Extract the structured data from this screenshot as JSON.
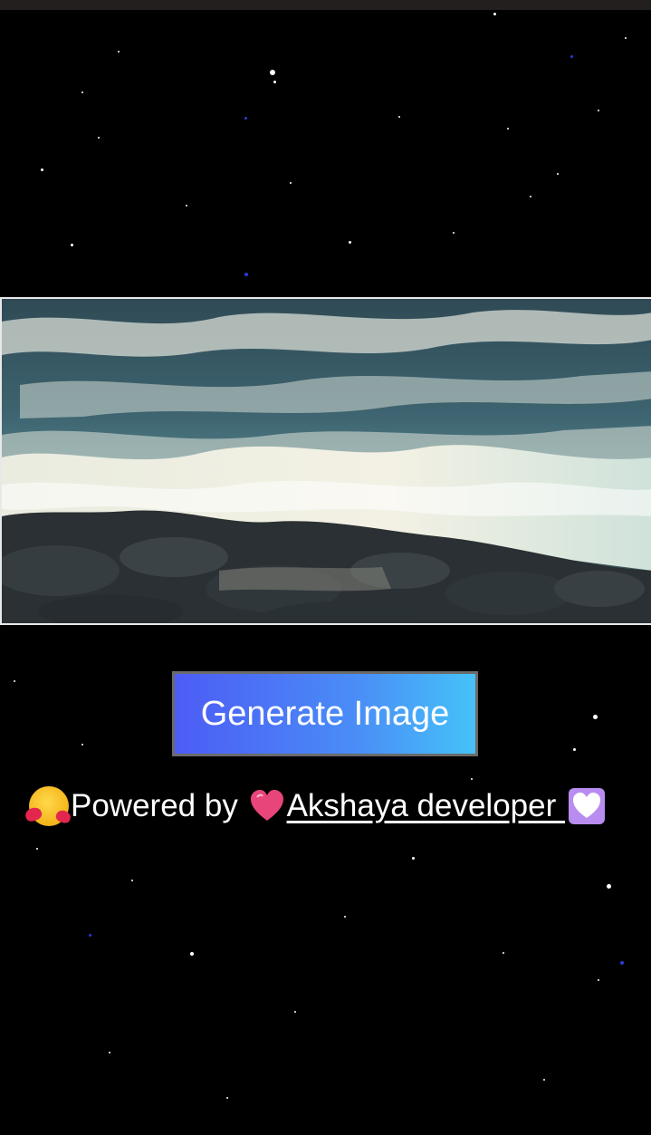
{
  "main": {
    "generate_button_label": "Generate Image",
    "photo_alt": "ocean waves crashing on rocks",
    "footer": {
      "prefix": "Powered by ",
      "link_text": "Akshaya developer ",
      "icons": [
        "smiling-face-with-hearts-icon",
        "pink-heart-icon",
        "white-heart-icon"
      ]
    }
  },
  "colors": {
    "background": "#000000",
    "button_gradient_start": "#4c5cf5",
    "button_gradient_end": "#45c2f8",
    "button_border": "#6b6b6b",
    "text": "#ffffff"
  }
}
